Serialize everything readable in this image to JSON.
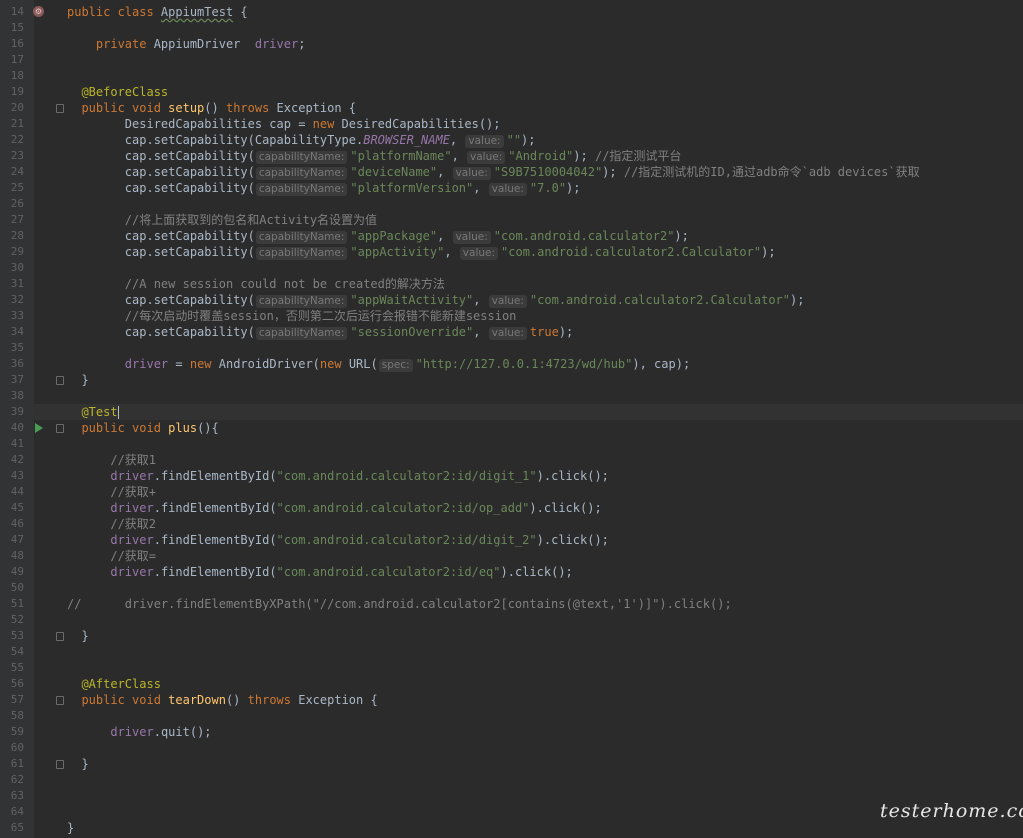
{
  "lines": [
    {
      "n": "14",
      "html": "<span class=\"kw\">public class </span><span class=\"cls-name\">AppiumTest</span> {"
    },
    {
      "n": "15",
      "html": ""
    },
    {
      "n": "16",
      "html": "    <span class=\"kw\">private </span>AppiumDriver  <span class=\"fld\">driver</span>;"
    },
    {
      "n": "17",
      "html": ""
    },
    {
      "n": "18",
      "html": ""
    },
    {
      "n": "19",
      "html": "  <span class=\"ann\">@BeforeClass</span>"
    },
    {
      "n": "20",
      "html": "  <span class=\"kw\">public void </span><span class=\"fn\">setup</span>() <span class=\"kw\">throws </span>Exception {"
    },
    {
      "n": "21",
      "html": "        DesiredCapabilities cap = <span class=\"kw\">new </span>DesiredCapabilities();"
    },
    {
      "n": "22",
      "html": "        cap.setCapability(CapabilityType.<span class=\"ital\">BROWSER_NAME</span>, <span class=\"hint\">value:</span><span class=\"str\">\"\"</span>);"
    },
    {
      "n": "23",
      "html": "        cap.setCapability(<span class=\"hint\">capabilityName:</span><span class=\"str\">\"platformName\"</span>, <span class=\"hint\">value:</span><span class=\"str\">\"Android\"</span>); <span class=\"cmt\">//指定测试平台</span>"
    },
    {
      "n": "24",
      "html": "        cap.setCapability(<span class=\"hint\">capabilityName:</span><span class=\"str\">\"deviceName\"</span>, <span class=\"hint\">value:</span><span class=\"str\">\"S9B7510004042\"</span>); <span class=\"cmt\">//指定测试机的ID,通过adb命令`adb devices`获取</span>"
    },
    {
      "n": "25",
      "html": "        cap.setCapability(<span class=\"hint\">capabilityName:</span><span class=\"str\">\"platformVersion\"</span>, <span class=\"hint\">value:</span><span class=\"str\">\"7.0\"</span>);"
    },
    {
      "n": "26",
      "html": ""
    },
    {
      "n": "27",
      "html": "        <span class=\"cmt\">//将上面获取到的包名和Activity名设置为值</span>"
    },
    {
      "n": "28",
      "html": "        cap.setCapability(<span class=\"hint\">capabilityName:</span><span class=\"str\">\"appPackage\"</span>, <span class=\"hint\">value:</span><span class=\"str\">\"com.android.calculator2\"</span>);"
    },
    {
      "n": "29",
      "html": "        cap.setCapability(<span class=\"hint\">capabilityName:</span><span class=\"str\">\"appActivity\"</span>, <span class=\"hint\">value:</span><span class=\"str\">\"com.android.calculator2.Calculator\"</span>);"
    },
    {
      "n": "30",
      "html": ""
    },
    {
      "n": "31",
      "html": "        <span class=\"cmt\">//A new session could not be created的解决方法</span>"
    },
    {
      "n": "32",
      "html": "        cap.setCapability(<span class=\"hint\">capabilityName:</span><span class=\"str\">\"appWaitActivity\"</span>, <span class=\"hint\">value:</span><span class=\"str\">\"com.android.calculator2.Calculator\"</span>);"
    },
    {
      "n": "33",
      "html": "        <span class=\"cmt\">//每次启动时覆盖session，否则第二次后运行会报错不能新建session</span>"
    },
    {
      "n": "34",
      "html": "        cap.setCapability(<span class=\"hint\">capabilityName:</span><span class=\"str\">\"sessionOverride\"</span>, <span class=\"hint\">value:</span><span class=\"kw\">true</span>);"
    },
    {
      "n": "35",
      "html": ""
    },
    {
      "n": "36",
      "html": "        <span class=\"fld\">driver</span> = <span class=\"kw\">new </span>AndroidDriver(<span class=\"kw\">new </span>URL(<span class=\"hint\">spec:</span><span class=\"str\">\"http://127.0.0.1:4723/wd/hub\"</span>), cap);"
    },
    {
      "n": "37",
      "html": "  }"
    },
    {
      "n": "38",
      "html": ""
    },
    {
      "n": "39",
      "html": "  <span class=\"ann\">@Test</span><span class=\"caret\"></span>"
    },
    {
      "n": "40",
      "html": "  <span class=\"kw\">public void </span><span class=\"fn\">plus</span>(){"
    },
    {
      "n": "41",
      "html": ""
    },
    {
      "n": "42",
      "html": "      <span class=\"cmt\">//获取1</span>"
    },
    {
      "n": "43",
      "html": "      <span class=\"fld\">driver</span>.findElementById(<span class=\"str\">\"com.android.calculator2:id/digit_1\"</span>).click();"
    },
    {
      "n": "44",
      "html": "      <span class=\"cmt\">//获取+</span>"
    },
    {
      "n": "45",
      "html": "      <span class=\"fld\">driver</span>.findElementById(<span class=\"str\">\"com.android.calculator2:id/op_add\"</span>).click();"
    },
    {
      "n": "46",
      "html": "      <span class=\"cmt\">//获取2</span>"
    },
    {
      "n": "47",
      "html": "      <span class=\"fld\">driver</span>.findElementById(<span class=\"str\">\"com.android.calculator2:id/digit_2\"</span>).click();"
    },
    {
      "n": "48",
      "html": "      <span class=\"cmt\">//获取=</span>"
    },
    {
      "n": "49",
      "html": "      <span class=\"fld\">driver</span>.findElementById(<span class=\"str\">\"com.android.calculator2:id/eq\"</span>).click();"
    },
    {
      "n": "50",
      "html": ""
    },
    {
      "n": "51",
      "html": "<span class=\"cmt\">//      driver.findElementByXPath(\"//com.android.calculator2[contains(@text,'1')]\").click();</span>"
    },
    {
      "n": "52",
      "html": ""
    },
    {
      "n": "53",
      "html": "  }"
    },
    {
      "n": "54",
      "html": ""
    },
    {
      "n": "55",
      "html": ""
    },
    {
      "n": "56",
      "html": "  <span class=\"ann\">@AfterClass</span>"
    },
    {
      "n": "57",
      "html": "  <span class=\"kw\">public void </span><span class=\"fn\">tearDown</span>() <span class=\"kw\">throws </span>Exception {"
    },
    {
      "n": "58",
      "html": ""
    },
    {
      "n": "59",
      "html": "      <span class=\"fld\">driver</span>.quit();"
    },
    {
      "n": "60",
      "html": ""
    },
    {
      "n": "61",
      "html": "  }"
    },
    {
      "n": "62",
      "html": ""
    },
    {
      "n": "63",
      "html": ""
    },
    {
      "n": "64",
      "html": ""
    },
    {
      "n": "65",
      "html": "}"
    }
  ],
  "fold_markers": [
    "20",
    "37",
    "40",
    "53",
    "57",
    "61"
  ],
  "run_markers": [
    "40"
  ],
  "gutter_icons": [
    {
      "line": "14",
      "icon": "annotation-icon"
    }
  ],
  "watermark": "testerhome.com",
  "colors": {
    "background": "#2b2b2b",
    "keyword": "#cc7832",
    "annotation": "#bbb529",
    "string": "#6a8759",
    "comment": "#808080",
    "field": "#9876aa",
    "method": "#ffc66d"
  }
}
